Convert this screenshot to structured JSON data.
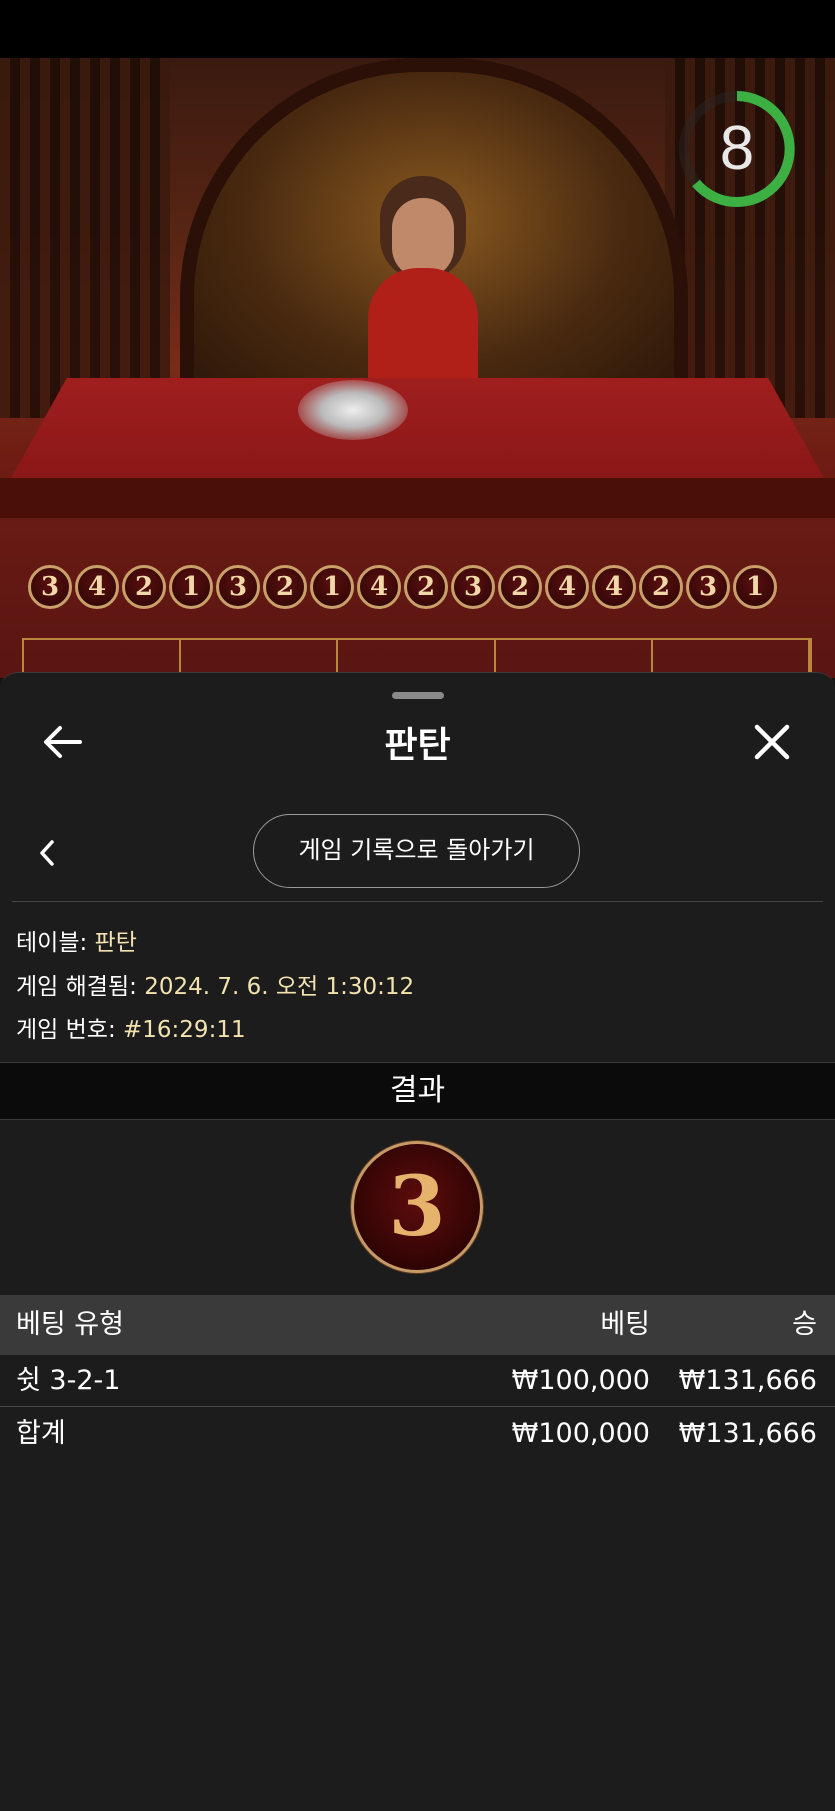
{
  "game": {
    "timer_value": "8",
    "timer_color": "#3cb043",
    "history_results": [
      "3",
      "4",
      "2",
      "1",
      "3",
      "2",
      "1",
      "4",
      "2",
      "3",
      "2",
      "4",
      "4",
      "2",
      "3",
      "1"
    ]
  },
  "panel": {
    "title": "판탄",
    "back_icon": "arrow-left-icon",
    "close_icon": "close-icon",
    "history_button_label": "게임 기록으로 돌아가기",
    "info": {
      "table_label": "테이블:",
      "table_value": "판탄",
      "resolved_label": "게임 해결됨:",
      "resolved_value": "2024. 7. 6. 오전 1:30:12",
      "game_no_label": "게임 번호:",
      "game_no_value": "#16:29:11"
    },
    "result_header": "결과",
    "result_value": "3",
    "table": {
      "headers": {
        "type": "베팅 유형",
        "bet": "베팅",
        "win": "승"
      },
      "rows": [
        {
          "type": "쉿 3-2-1",
          "bet": "₩100,000",
          "win": "₩131,666"
        }
      ],
      "total": {
        "type": "합계",
        "bet": "₩100,000",
        "win": "₩131,666"
      }
    }
  },
  "colors": {
    "accent_gold": "#f3e2b0",
    "panel_bg": "#1c1c1c",
    "header_bg": "#3a3a3a"
  }
}
